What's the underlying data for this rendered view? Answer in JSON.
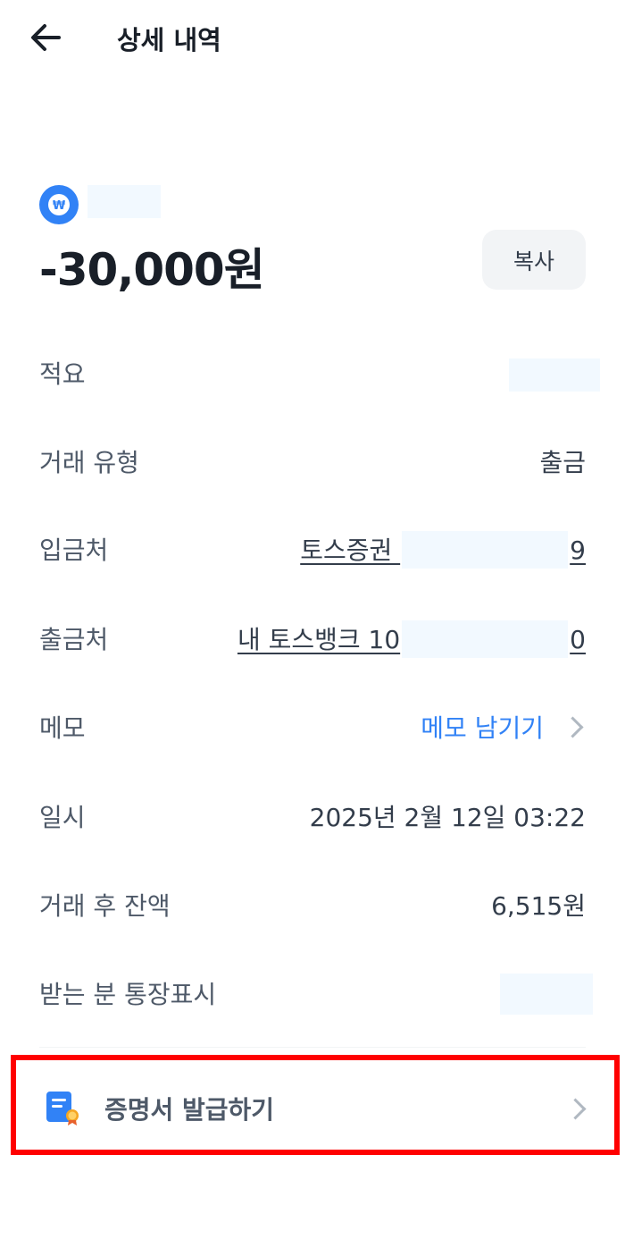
{
  "header": {
    "title": "상세 내역",
    "back_icon": "arrow-left-icon"
  },
  "summary": {
    "account_icon": "won-coin-icon",
    "account_icon_glyph": "₩",
    "amount": "-30,000원",
    "copy_label": "복사"
  },
  "details": {
    "rows": [
      {
        "label": "적요",
        "value": ""
      },
      {
        "label": "거래 유형",
        "value": "출금"
      },
      {
        "label": "입금처",
        "value_prefix": "토스증권 ",
        "value_suffix": "9"
      },
      {
        "label": "출금처",
        "value_prefix": "내 토스뱅크 10",
        "value_suffix": "0"
      },
      {
        "label": "메모",
        "value": "메모 남기기"
      },
      {
        "label": "일시",
        "value": "2025년 2월 12일 03:22"
      },
      {
        "label": "거래 후 잔액",
        "value": "6,515원"
      },
      {
        "label": "받는 분 통장표시",
        "value": ""
      }
    ]
  },
  "certificate": {
    "label": "증명서 발급하기",
    "icon": "document-certificate-icon"
  },
  "colors": {
    "accent": "#3182f6",
    "text_primary": "#191f28",
    "text_secondary": "#4e5968",
    "highlight": "#ff0000",
    "mask": "#f2f9ff"
  }
}
